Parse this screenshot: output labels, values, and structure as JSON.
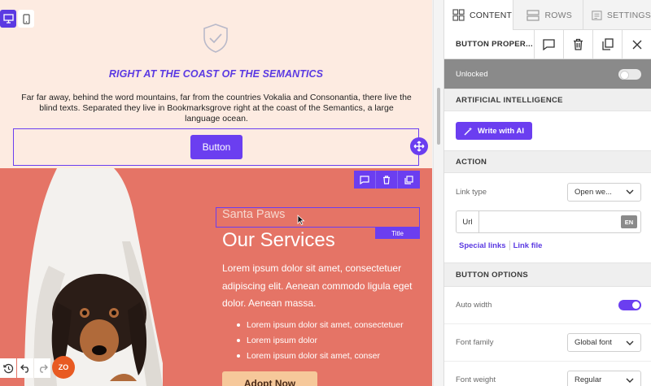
{
  "canvas": {
    "section_title": "RIGHT AT THE COAST OF THE SEMANTICS",
    "section_body": "Far far away, behind the word mountains, far from the countries Vokalia and Consonantia, there live the blind texts. Separated they live in Bookmarksgrove right at the coast of the Semantics, a large language ocean.",
    "button_text": "Button",
    "small_title": "Santa Paws",
    "title_tag": "Title",
    "heading": "Our Services",
    "paragraph": "Lorem ipsum dolor sit amet, consectetuer adipiscing elit. Aenean commodo ligula eget dolor. Aenean massa.",
    "list": [
      "Lorem ipsum dolor sit amet, consectetuer",
      "Lorem ipsum dolor",
      "Lorem ipsum dolor sit amet, conser"
    ],
    "cta": "Adopt Now",
    "avatar": "ZO"
  },
  "panel": {
    "tabs": [
      {
        "label": "CONTENT",
        "icon": "grid-icon"
      },
      {
        "label": "ROWS",
        "icon": "rows-icon"
      },
      {
        "label": "SETTINGS",
        "icon": "settings-icon"
      }
    ],
    "props_title": "BUTTON PROPER...",
    "lock_label": "Unlocked",
    "ai_heading": "ARTIFICIAL INTELLIGENCE",
    "ai_button": "Write with AI",
    "action_heading": "ACTION",
    "link_type_label": "Link type",
    "link_type_value": "Open we...",
    "url_label": "Url",
    "url_value": "",
    "url_lang": "EN",
    "special_links": "Special links",
    "link_file": "Link file",
    "options_heading": "BUTTON OPTIONS",
    "auto_width_label": "Auto width",
    "font_family_label": "Font family",
    "font_family_value": "Global font",
    "font_weight_label": "Font weight",
    "font_weight_value": "Regular"
  },
  "colors": {
    "accent": "#6b3ef0",
    "hero_bg": "#fdebe1",
    "services_bg": "#e57466",
    "cta_bg": "#f6c89a",
    "avatar_bg": "#e85a22"
  }
}
